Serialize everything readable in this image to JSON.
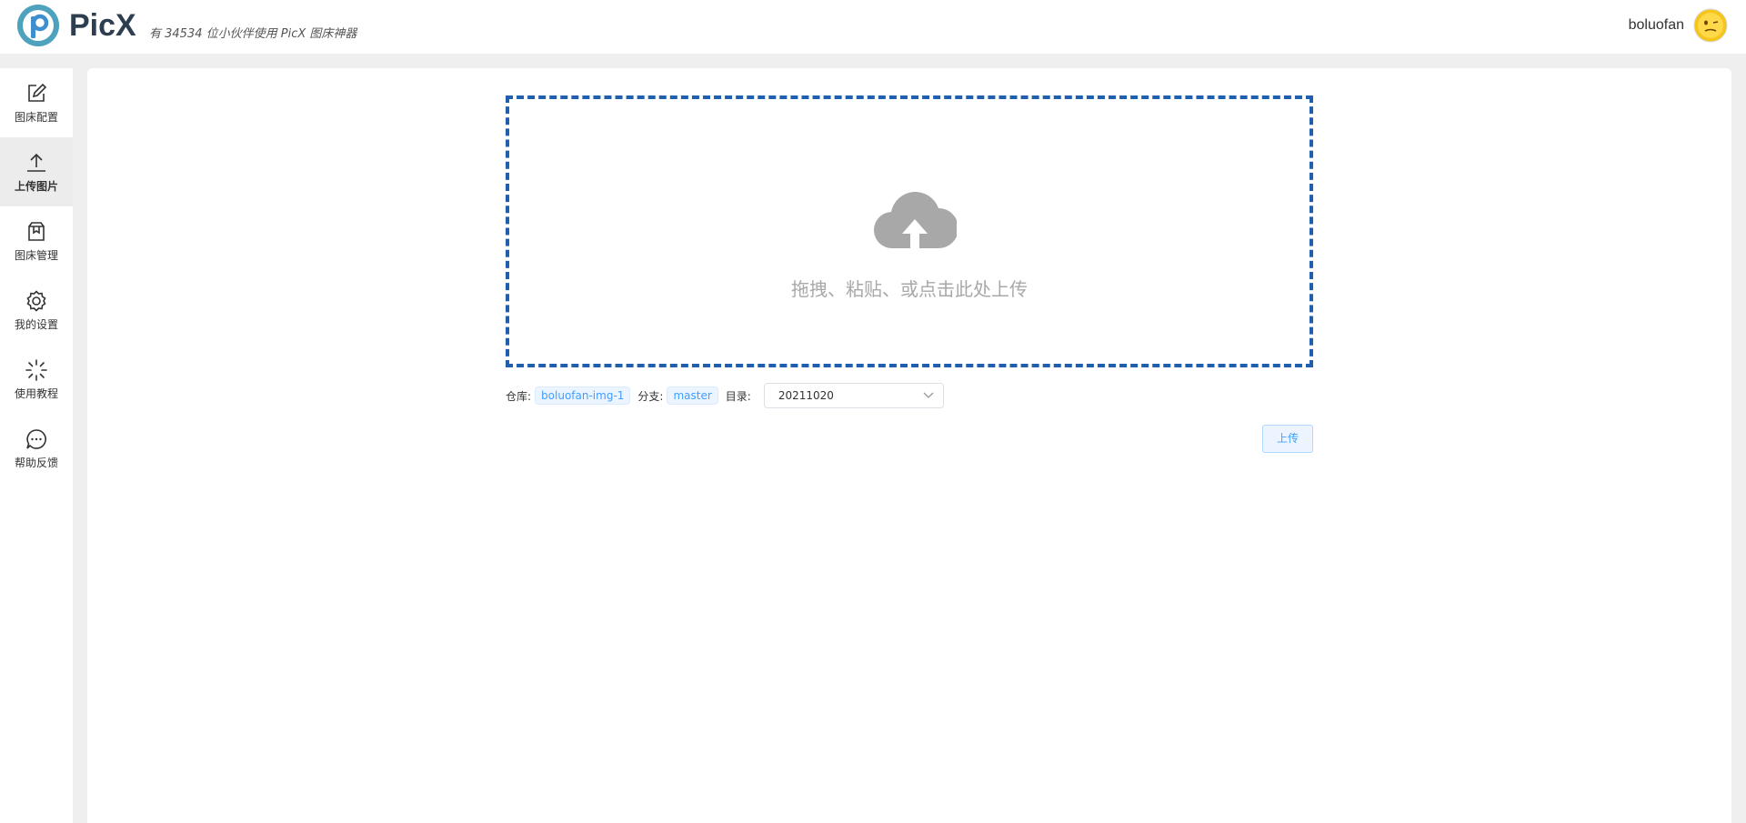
{
  "header": {
    "logo_text": "PicX",
    "slogan": "有 34534 位小伙伴使用 PicX 图床神器",
    "username": "boluofan"
  },
  "sidebar": {
    "items": [
      {
        "label": "图床配置",
        "icon": "edit-icon",
        "active": false
      },
      {
        "label": "上传图片",
        "icon": "upload-icon",
        "active": true
      },
      {
        "label": "图床管理",
        "icon": "package-icon",
        "active": false
      },
      {
        "label": "我的设置",
        "icon": "gear-icon",
        "active": false
      },
      {
        "label": "使用教程",
        "icon": "loading-icon",
        "active": false
      },
      {
        "label": "帮助反馈",
        "icon": "chat-icon",
        "active": false
      }
    ]
  },
  "upload": {
    "dropzone_text": "拖拽、粘贴、或点击此处上传",
    "repo_label": "仓库:",
    "repo_value": "boluofan-img-1",
    "branch_label": "分支:",
    "branch_value": "master",
    "dir_label": "目录:",
    "dir_value": "20211020",
    "upload_button": "上传"
  },
  "colors": {
    "accent": "#409eff",
    "dropzone_border": "#1f5fae",
    "logo_text": "#2c3e50"
  }
}
